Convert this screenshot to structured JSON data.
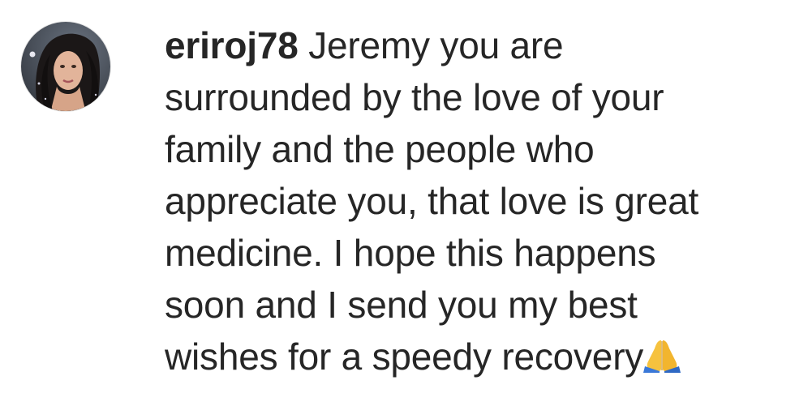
{
  "comment": {
    "username": "eriroj78",
    "lines": [
      " Jeremy you are",
      "surrounded by the love of your",
      "family and the people who",
      "appreciate you, that love is great",
      "medicine. I hope this happens",
      "soon and I send you my best",
      "wishes for a speedy recovery"
    ],
    "trailing_emoji": "folded-hands-emoji"
  },
  "colors": {
    "text": "#262626",
    "avatar_border": "#e6e6e6"
  }
}
